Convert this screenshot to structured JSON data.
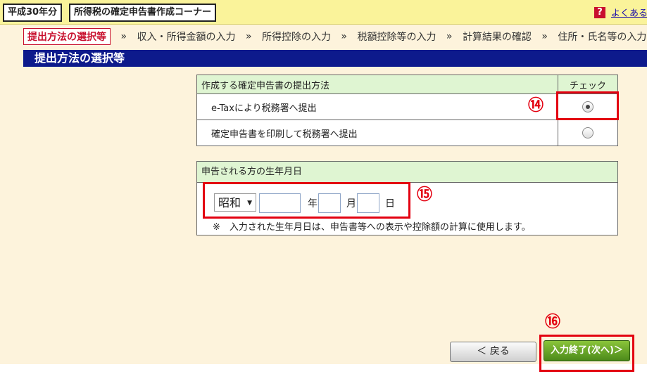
{
  "header": {
    "year_label": "平成30年分",
    "corner_label": "所得税の確定申告書作成コーナー",
    "help_icon": "?",
    "help_link": "よくある"
  },
  "steps": [
    {
      "label": "提出方法の選択等",
      "current": true
    },
    {
      "label": "収入・所得金額の入力"
    },
    {
      "label": "所得控除の入力"
    },
    {
      "label": "税額控除等の入力"
    },
    {
      "label": "計算結果の確認"
    },
    {
      "label": "住所・氏名等の入力"
    }
  ],
  "step_separator": "»",
  "section_title": "提出方法の選択等",
  "submission": {
    "header_label": "作成する確定申告書の提出方法",
    "check_header": "チェック",
    "options": [
      {
        "label": "e-Taxにより税務署へ提出",
        "checked": true
      },
      {
        "label": "確定申告書を印刷して税務署へ提出",
        "checked": false
      }
    ]
  },
  "birthdate": {
    "header_label": "申告される方の生年月日",
    "era": "昭和",
    "era_arrow": "▼",
    "year_value": "",
    "month_value": "",
    "day_value": "",
    "year_unit": "年",
    "month_unit": "月",
    "day_unit": "日",
    "note": "※　入力された生年月日は、申告書等への表示や控除額の計算に使用します。"
  },
  "annotations": {
    "n14": "⑭",
    "n15": "⑮",
    "n16": "⑯"
  },
  "buttons": {
    "back": "＜ 戻る",
    "next": "入力終了(次へ)＞"
  },
  "colors": {
    "section_title_bg": "#0d1a8c",
    "header_bg": "#faf39a",
    "table_header_bg": "#dff5d2",
    "annotation_red": "#e30010",
    "next_button_green": "#4c8a1a"
  }
}
